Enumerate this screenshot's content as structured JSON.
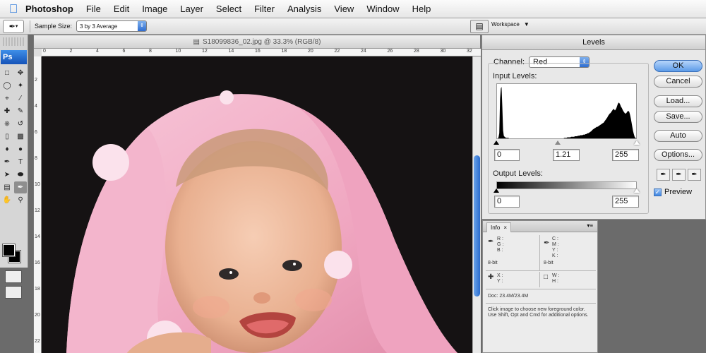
{
  "menubar": {
    "items": [
      "Photoshop",
      "File",
      "Edit",
      "Image",
      "Layer",
      "Select",
      "Filter",
      "Analysis",
      "View",
      "Window",
      "Help"
    ]
  },
  "options_bar": {
    "sample_size_label": "Sample Size:",
    "sample_size_value": "3 by 3 Average",
    "workspace_label": "Workspace"
  },
  "tools": {
    "logo": "Ps",
    "icons": [
      "marquee-icon",
      "move-icon",
      "lasso-icon",
      "magic-wand-icon",
      "crop-icon",
      "slice-icon",
      "healing-brush-icon",
      "brush-icon",
      "clone-stamp-icon",
      "history-brush-icon",
      "eraser-icon",
      "gradient-icon",
      "blur-icon",
      "dodge-icon",
      "pen-icon",
      "type-icon",
      "path-selection-icon",
      "shape-icon",
      "notes-icon",
      "eyedropper-icon",
      "hand-icon",
      "zoom-icon"
    ]
  },
  "document": {
    "title": "S18099836_02.jpg @ 33.3% (RGB/8)",
    "ruler_ticks": [
      "0",
      "2",
      "4",
      "6",
      "8",
      "10",
      "12",
      "14",
      "16",
      "18",
      "20",
      "22",
      "24",
      "26",
      "28",
      "30",
      "32"
    ],
    "ruler_v_ticks": [
      "2",
      "4",
      "6",
      "8",
      "10",
      "12",
      "14",
      "16",
      "18",
      "20",
      "22"
    ]
  },
  "levels": {
    "title": "Levels",
    "channel_label": "Channel:",
    "channel_value": "Red",
    "input_levels_label": "Input Levels:",
    "input_black": "0",
    "input_gamma": "1.21",
    "input_white": "255",
    "output_levels_label": "Output Levels:",
    "output_black": "0",
    "output_white": "255",
    "buttons": {
      "ok": "OK",
      "cancel": "Cancel",
      "load": "Load...",
      "save": "Save...",
      "auto": "Auto",
      "options": "Options..."
    },
    "preview_label": "Preview",
    "preview_checked": true,
    "histogram": [
      0,
      0,
      2,
      10,
      75,
      95,
      98,
      60,
      15,
      5,
      3,
      2,
      1,
      1,
      1,
      1,
      0,
      0,
      0,
      0,
      0,
      0,
      0,
      0,
      0,
      0,
      0,
      0,
      0,
      0,
      0,
      0,
      0,
      0,
      0,
      0,
      0,
      0,
      0,
      0,
      0,
      0,
      0,
      0,
      0,
      0,
      0,
      0,
      0,
      0,
      0,
      0,
      0,
      0,
      0,
      0,
      0,
      0,
      0,
      0,
      0,
      0,
      0,
      0,
      0,
      0,
      0,
      0,
      0,
      0,
      0,
      0,
      0,
      0,
      0,
      0,
      0,
      0,
      0,
      0,
      0,
      0,
      0,
      0,
      0,
      0,
      0,
      0,
      0,
      1,
      1,
      1,
      1,
      2,
      2,
      2,
      2,
      2,
      3,
      3,
      3,
      3,
      3,
      4,
      4,
      4,
      4,
      5,
      5,
      5,
      6,
      6,
      6,
      6,
      7,
      7,
      7,
      8,
      8,
      9,
      10,
      10,
      11,
      12,
      13,
      14,
      16,
      17,
      18,
      19,
      20,
      21,
      22,
      22,
      23,
      24,
      25,
      26,
      27,
      28,
      29,
      30,
      32,
      34,
      36,
      38,
      40,
      43,
      45,
      47,
      48,
      50,
      52,
      54,
      56,
      55,
      53,
      55,
      58,
      62,
      66,
      68,
      67,
      64,
      60,
      58,
      55,
      52,
      50,
      48,
      47,
      48,
      50,
      52,
      52,
      50,
      45,
      38,
      30,
      22,
      14,
      8,
      3,
      1,
      0
    ]
  },
  "info": {
    "tab_label": "Info",
    "close_glyph": "×",
    "menu_glyph": "▾≡",
    "rgb_labels": [
      "R :",
      "G :",
      "B :"
    ],
    "cmyk_labels": [
      "C :",
      "M :",
      "Y :",
      "K :"
    ],
    "bit_left": "8-bit",
    "bit_right": "8-bit",
    "xy_labels": [
      "X :",
      "Y :"
    ],
    "wh_labels": [
      "W :",
      "H :"
    ],
    "doc_line": "Doc: 23.4M/23.4M",
    "help_text": "Click image to choose new foreground color.  Use Shift, Opt and Cmd for additional options."
  }
}
